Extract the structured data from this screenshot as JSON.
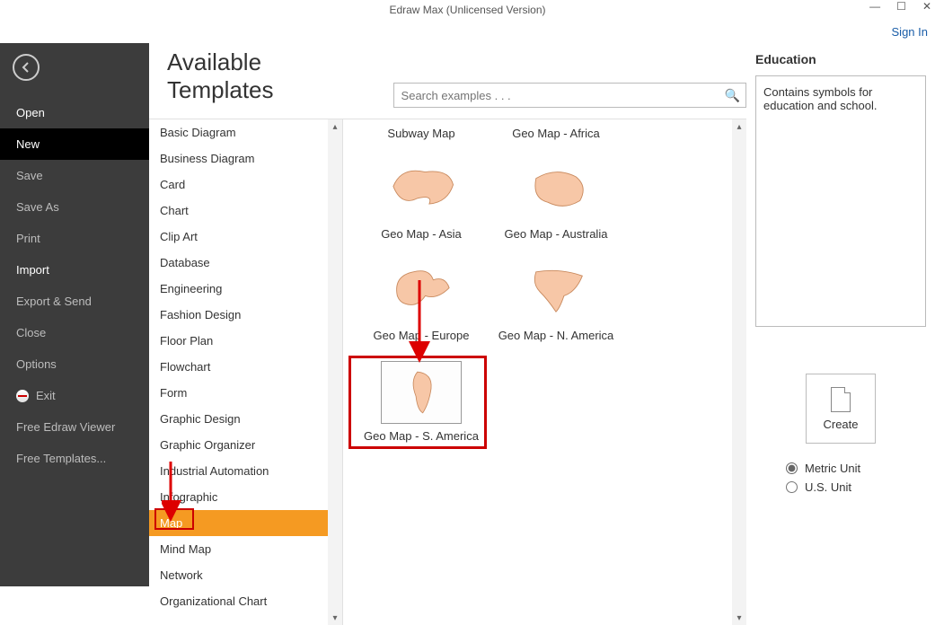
{
  "window": {
    "title": "Edraw Max (Unlicensed Version)",
    "signin": "Sign In"
  },
  "nav": {
    "items": [
      {
        "label": "Open",
        "bright": true
      },
      {
        "label": "New",
        "selected": true
      },
      {
        "label": "Save"
      },
      {
        "label": "Save As"
      },
      {
        "label": "Print"
      },
      {
        "label": "Import",
        "bright": true
      },
      {
        "label": "Export & Send"
      },
      {
        "label": "Close"
      },
      {
        "label": "Options"
      },
      {
        "label": "Exit",
        "icon": "exit"
      },
      {
        "label": "Free Edraw Viewer"
      },
      {
        "label": "Free Templates..."
      }
    ]
  },
  "heading": "Available Templates",
  "search_placeholder": "Search examples . . .",
  "categories": [
    "Basic Diagram",
    "Business Diagram",
    "Card",
    "Chart",
    "Clip Art",
    "Database",
    "Engineering",
    "Fashion Design",
    "Floor Plan",
    "Flowchart",
    "Form",
    "Graphic Design",
    "Graphic Organizer",
    "Industrial Automation",
    "Infographic",
    "Map",
    "Mind Map",
    "Network",
    "Organizational Chart"
  ],
  "selected_category_index": 15,
  "templates_row1": [
    "Subway Map",
    "Geo Map - Africa"
  ],
  "templates": [
    {
      "label": "Geo Map - Asia",
      "shape": "asia"
    },
    {
      "label": "Geo Map - Australia",
      "shape": "australia"
    },
    {
      "label": "Geo Map - Europe",
      "shape": "europe"
    },
    {
      "label": "Geo Map - N. America",
      "shape": "namerica"
    },
    {
      "label": "Geo Map - S. America",
      "shape": "samerica",
      "selected": true
    }
  ],
  "info": {
    "title": "Education",
    "desc": "Contains symbols for education and school."
  },
  "create_label": "Create",
  "units": {
    "metric": "Metric Unit",
    "us": "U.S. Unit",
    "selected": "metric"
  }
}
